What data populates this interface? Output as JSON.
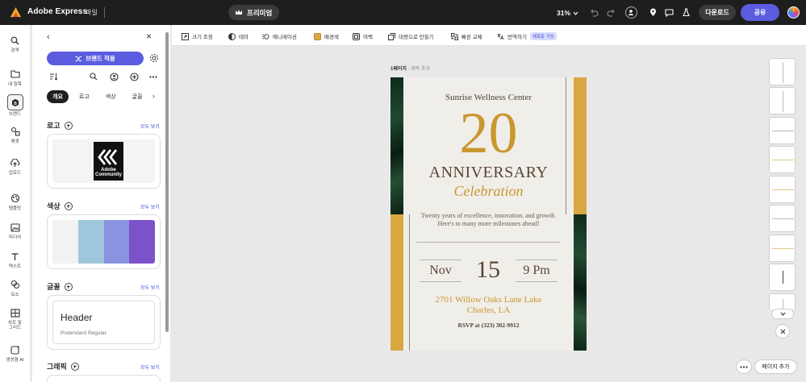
{
  "topbar": {
    "app_name": "Adobe Express",
    "file_menu": "파일",
    "premium": "프리미엄",
    "zoom": "31%",
    "download": "다운로드",
    "share": "공유"
  },
  "rail": [
    {
      "label": "검색",
      "icon": "search-icon"
    },
    {
      "label": "내 항목",
      "icon": "folder-icon"
    },
    {
      "label": "브랜드",
      "icon": "brand-icon"
    },
    {
      "label": "에셋",
      "icon": "shapes-icon"
    },
    {
      "label": "업로드",
      "icon": "upload-icon"
    },
    {
      "label": "템플릿",
      "icon": "template-icon"
    },
    {
      "label": "미디어",
      "icon": "media-icon"
    },
    {
      "label": "텍스트",
      "icon": "text-icon"
    },
    {
      "label": "요소",
      "icon": "elements-icon"
    },
    {
      "label": "차트 및\n그리드",
      "icon": "chart-icon"
    },
    {
      "label": "생성형 AI",
      "icon": "ai-icon"
    }
  ],
  "panel": {
    "brand_button": "브랜드 적용",
    "chips": [
      "개요",
      "로고",
      "색상",
      "글꼴"
    ],
    "sections": {
      "logo": {
        "title": "로고",
        "see_all": "모두 보기"
      },
      "colors": {
        "title": "색상",
        "see_all": "모두 보기"
      },
      "fonts": {
        "title": "글꼴",
        "see_all": "모두 보기"
      },
      "graphics": {
        "title": "그래픽",
        "see_all": "모두 보기"
      }
    },
    "logo_text_1": "Adobe",
    "logo_text_2": "Community",
    "palette": [
      "#f2f2f2",
      "#9ec7dc",
      "#8a93e0",
      "#7b52c9"
    ],
    "font_preview": "Header",
    "font_name": "Pretendard Regular"
  },
  "toolbar": [
    {
      "label": "크기 조정",
      "icon": "resize-icon"
    },
    {
      "label": "테마",
      "icon": "theme-icon"
    },
    {
      "label": "애니메이션",
      "icon": "animation-icon"
    },
    {
      "label": "배경색",
      "icon": "background-color-icon"
    },
    {
      "label": "여백",
      "icon": "margin-icon"
    },
    {
      "label": "대량으로 만들기",
      "icon": "bulk-create-icon"
    },
    {
      "label": "빠른 교체",
      "icon": "quick-swap-icon"
    },
    {
      "label": "번역하기",
      "icon": "translate-icon"
    }
  ],
  "toolbar_badge": "새로운 기능",
  "canvas": {
    "page_label": "1페이지",
    "page_sub": " - 제목 추가",
    "org": "Sunrise Wellness Center",
    "number": "20",
    "anniversary": "ANNIVERSARY",
    "celebration": "Celebration",
    "desc_1": "Twenty years of excellence, innovation, and growth.",
    "desc_2": "Here's to many more milestones ahead!",
    "month": "Nov",
    "day": "15",
    "time": "9 Pm",
    "addr_1": "2701 Willow Oaks Lane Lake",
    "addr_2": "Charles, LA",
    "rsvp": "RSVP at (323) 302-9912"
  },
  "pages_panel": {
    "add_page": "페이지 추가"
  },
  "colors": {
    "accent": "#5c5ce0",
    "gold": "#d9a842",
    "topbar": "#1e1e1e"
  }
}
